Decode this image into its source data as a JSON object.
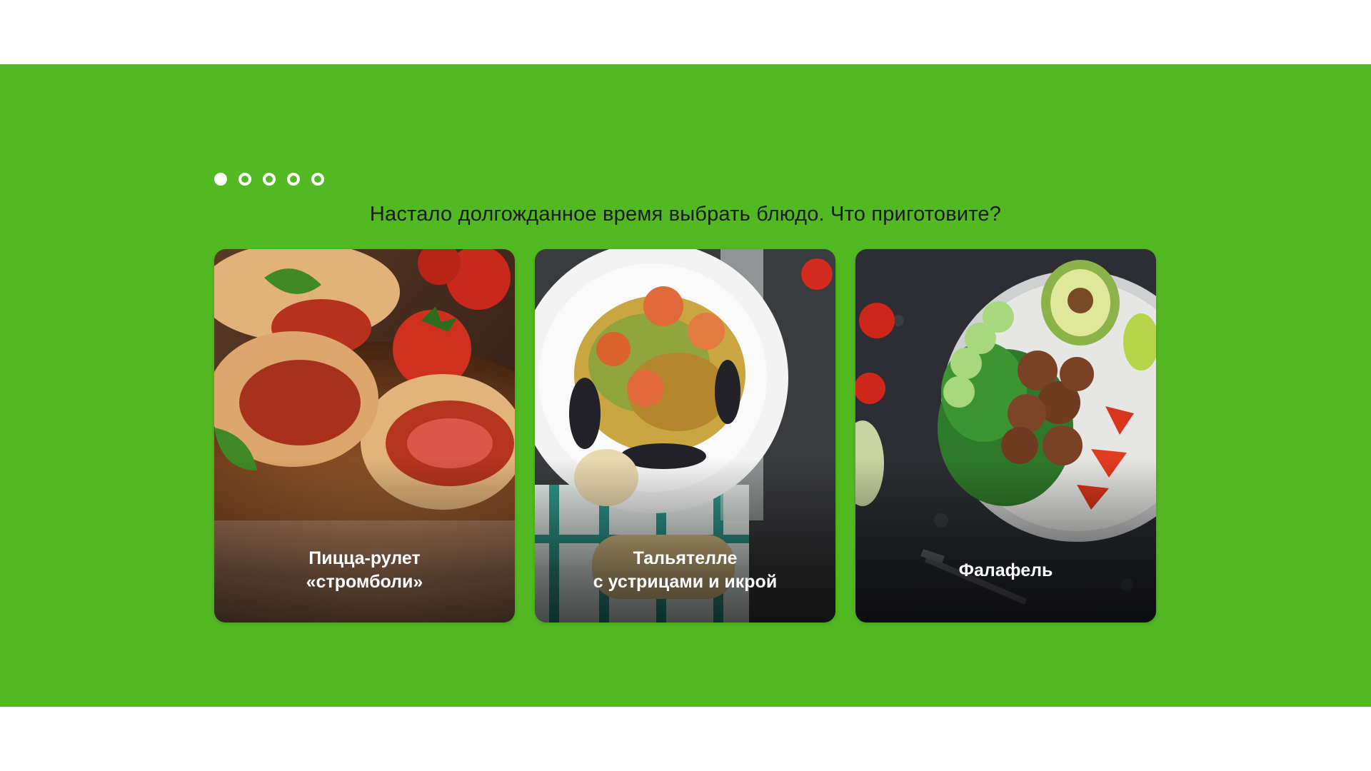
{
  "carousel": {
    "dots": [
      {
        "active": true
      },
      {
        "active": false
      },
      {
        "active": false
      },
      {
        "active": false
      },
      {
        "active": false
      }
    ],
    "question": "Настало долгожданное время выбрать блюдо. Что приготовите?"
  },
  "dishes": [
    {
      "line1": "Пицца-рулет",
      "line2": "«строմболи»"
    },
    {
      "line1": "Тальятелле",
      "line2": "с устрицами и икрой"
    },
    {
      "line1": "Фалафель",
      "line2": ""
    }
  ],
  "colors": {
    "accent_green": "#52b923",
    "text_dark": "#1a1a1a",
    "caption_text": "#ffffff"
  }
}
